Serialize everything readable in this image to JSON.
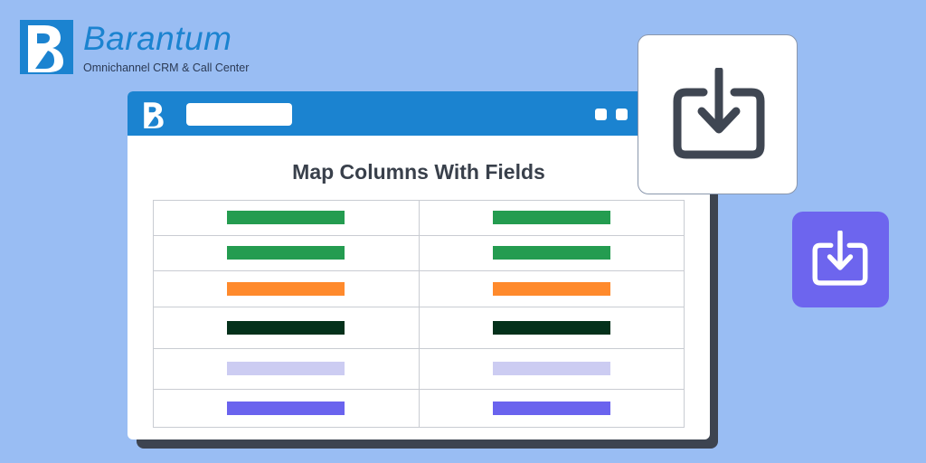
{
  "brand": {
    "name": "Barantum",
    "tagline": "Omnichannel CRM & Call Center",
    "color": "#1b83d0"
  },
  "window": {
    "title": "Map Columns With Fields",
    "titlebar_color": "#1b83d0"
  },
  "mapping_rows": [
    {
      "source_color": "#249c50",
      "target_color": "#249c50"
    },
    {
      "source_color": "#249c50",
      "target_color": "#249c50"
    },
    {
      "source_color": "#ff8a2c",
      "target_color": "#ff8a2c"
    },
    {
      "source_color": "#04311b",
      "target_color": "#04311b"
    },
    {
      "source_color": "#ccccf2",
      "target_color": "#ccccf2"
    },
    {
      "source_color": "#6a63ee",
      "target_color": "#6a63ee"
    }
  ],
  "icons": {
    "large_card": "import-download-icon",
    "small_card": "import-download-icon",
    "small_card_color": "#6d65ee"
  }
}
